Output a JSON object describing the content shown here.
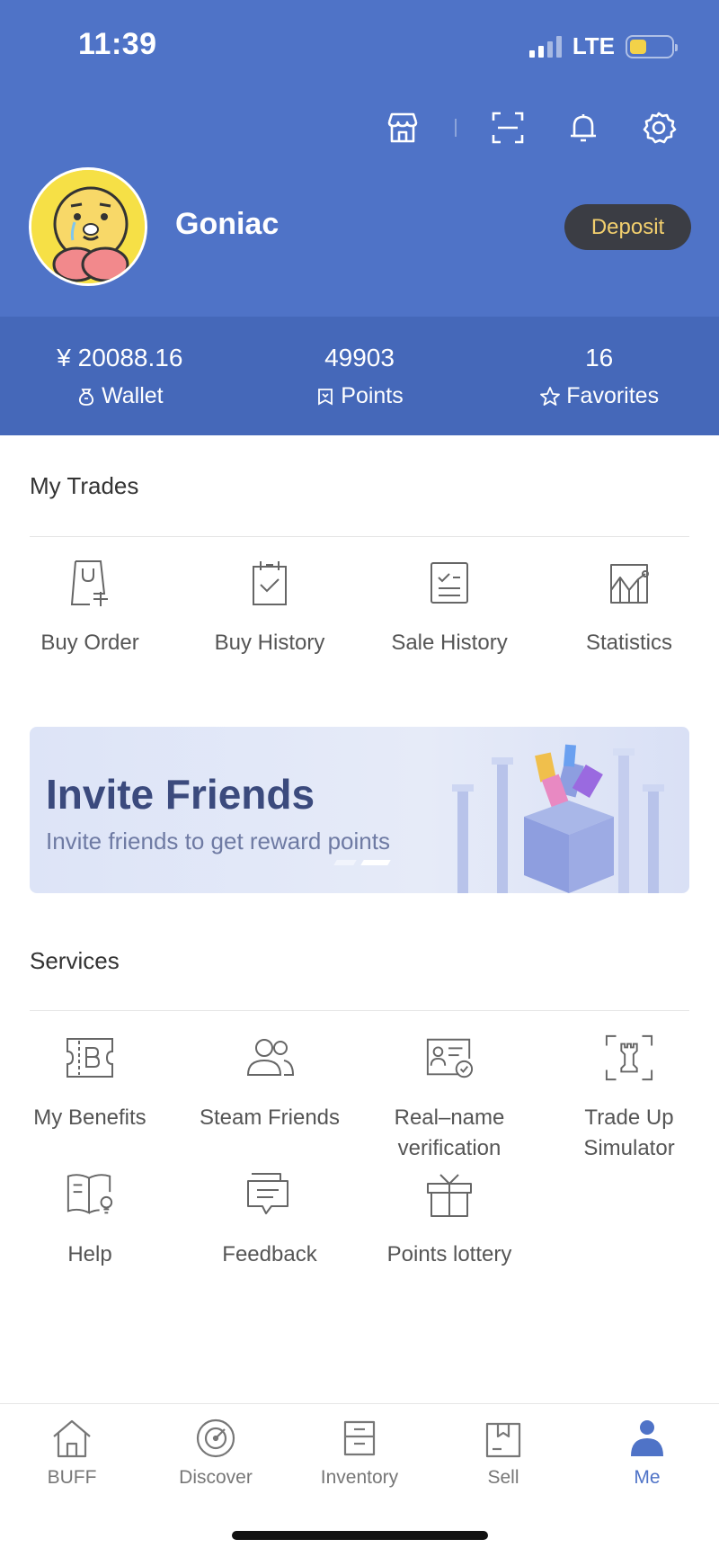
{
  "status_bar": {
    "time": "11:39",
    "network": "LTE",
    "battery_level": 0.42
  },
  "header": {
    "icons": [
      "store-icon",
      "scan-icon",
      "bell-icon",
      "gear-icon"
    ],
    "username": "Goniac",
    "deposit_label": "Deposit"
  },
  "stats": [
    {
      "value": "¥ 20088.16",
      "label": "Wallet",
      "icon": "wallet-icon"
    },
    {
      "value": "49903",
      "label": "Points",
      "icon": "points-icon"
    },
    {
      "value": "16",
      "label": "Favorites",
      "icon": "star-icon"
    }
  ],
  "my_trades": {
    "title": "My Trades",
    "items": [
      {
        "label": "Buy Order",
        "icon": "buy-order-icon"
      },
      {
        "label": "Buy History",
        "icon": "buy-history-icon"
      },
      {
        "label": "Sale History",
        "icon": "sale-history-icon"
      },
      {
        "label": "Statistics",
        "icon": "statistics-icon"
      }
    ]
  },
  "banner": {
    "title": "Invite Friends",
    "subtitle": "Invite friends to get reward points"
  },
  "services": {
    "title": "Services",
    "items": [
      {
        "label": "My Benefits",
        "icon": "benefits-icon"
      },
      {
        "label": "Steam Friends",
        "icon": "friends-icon"
      },
      {
        "label": "Real-name verification",
        "line1": "Real–name",
        "line2": "verification",
        "icon": "id-card-icon"
      },
      {
        "label": "Trade Up Simulator",
        "line1": "Trade Up",
        "line2": "Simulator",
        "icon": "tradeup-icon"
      },
      {
        "label": "Help",
        "icon": "help-book-icon"
      },
      {
        "label": "Feedback",
        "icon": "feedback-icon"
      },
      {
        "label": "Points lottery",
        "icon": "gift-icon"
      }
    ]
  },
  "bottom_nav": {
    "active": "Me",
    "accent_color": "#4f73c7",
    "items": [
      {
        "label": "BUFF",
        "icon": "home-icon"
      },
      {
        "label": "Discover",
        "icon": "discover-icon"
      },
      {
        "label": "Inventory",
        "icon": "inventory-icon"
      },
      {
        "label": "Sell",
        "icon": "sell-icon"
      },
      {
        "label": "Me",
        "icon": "person-icon"
      }
    ]
  },
  "colors": {
    "header_bg": "#4f73c7",
    "stats_bg": "#4568b9",
    "deposit_text": "#f2cf6e"
  }
}
